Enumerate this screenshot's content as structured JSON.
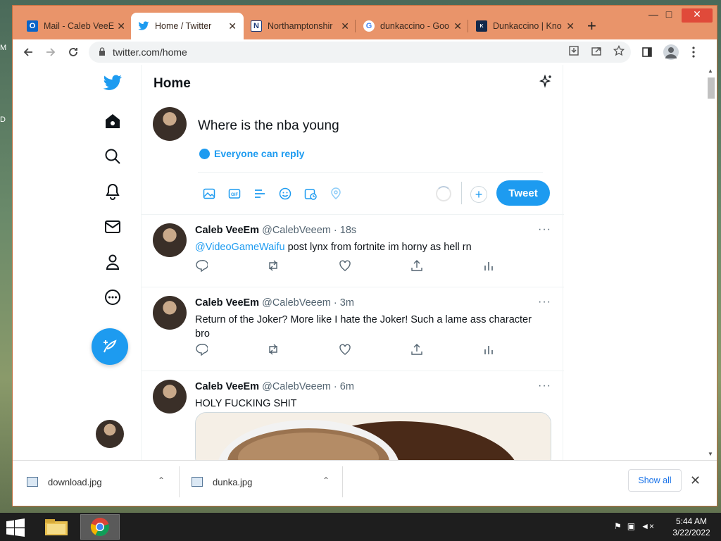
{
  "desktop": {
    "fragment_top": "M",
    "fragment_mid": "D"
  },
  "browser": {
    "tabs": [
      {
        "label": "Mail - Caleb VeeE",
        "icon": "outlook-icon",
        "active": false
      },
      {
        "label": "Home / Twitter",
        "icon": "twitter-icon",
        "active": true
      },
      {
        "label": "Northamptonshir",
        "icon": "newspaper-icon",
        "active": false
      },
      {
        "label": "dunkaccino - Goo",
        "icon": "google-icon",
        "active": false
      },
      {
        "label": "Dunkaccino | Kno",
        "icon": "knowyourmeme-icon",
        "active": false
      }
    ],
    "address": "twitter.com/home",
    "window_controls": {
      "minimize": "—",
      "maximize": "□",
      "close": "✕"
    }
  },
  "twitter": {
    "page_title": "Home",
    "composer": {
      "text": "Where is the nba young",
      "reply_setting": "Everyone can reply",
      "tweet_button": "Tweet"
    },
    "tweets": [
      {
        "name": "Caleb VeeEm",
        "handle": "@CalebVeeem",
        "time": "18s",
        "mention": "@VideoGameWaifu",
        "text": " post lynx from fortnite im horny as hell rn"
      },
      {
        "name": "Caleb VeeEm",
        "handle": "@CalebVeeem",
        "time": "3m",
        "text": "Return of the Joker? More like I hate the Joker! Such a lame ass character bro"
      },
      {
        "name": "Caleb VeeEm",
        "handle": "@CalebVeeem",
        "time": "6m",
        "text": "HOLY FUCKING SHIT"
      }
    ]
  },
  "downloads": {
    "items": [
      {
        "filename": "download.jpg"
      },
      {
        "filename": "dunka.jpg"
      }
    ],
    "show_all": "Show all"
  },
  "taskbar": {
    "time": "5:44 AM",
    "date": "3/22/2022"
  },
  "colors": {
    "twitter_blue": "#1d9bf0",
    "titlebar": "#e9946a"
  }
}
